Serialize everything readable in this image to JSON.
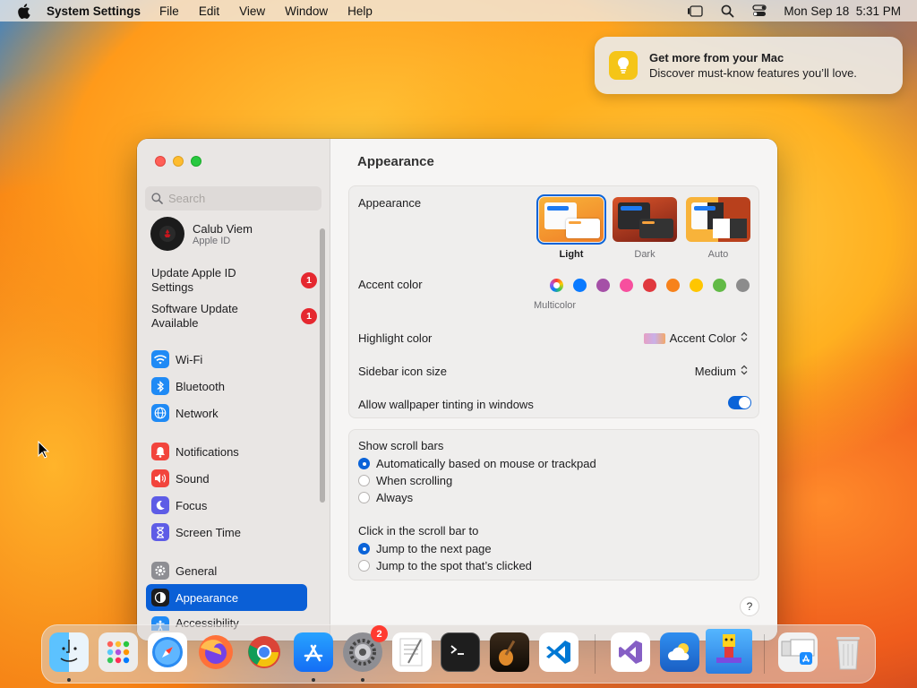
{
  "menubar": {
    "app_name": "System Settings",
    "menus": [
      "File",
      "Edit",
      "View",
      "Window",
      "Help"
    ],
    "datetime": "Mon Sep 18  5:31 PM"
  },
  "notification": {
    "title": "Get more from your Mac",
    "body": "Discover must-know features you’ll love."
  },
  "sidebar": {
    "search_placeholder": "Search",
    "account_name": "Calub Viem",
    "account_sub": "Apple ID",
    "alerts": [
      {
        "label": "Update Apple ID Settings",
        "badge": "1"
      },
      {
        "label": "Software Update Available",
        "badge": "1"
      }
    ],
    "items": [
      {
        "label": "Wi-Fi"
      },
      {
        "label": "Bluetooth"
      },
      {
        "label": "Network"
      },
      {
        "label": "Notifications"
      },
      {
        "label": "Sound"
      },
      {
        "label": "Focus"
      },
      {
        "label": "Screen Time"
      },
      {
        "label": "General"
      },
      {
        "label": "Appearance"
      },
      {
        "label": "Accessibility"
      }
    ]
  },
  "main": {
    "title": "Appearance",
    "appearance_label": "Appearance",
    "themes": [
      "Light",
      "Dark",
      "Auto"
    ],
    "selected_theme": "Light",
    "accent_label": "Accent color",
    "accent_selected_name": "Multicolor",
    "accent_colors": [
      "#ff3b30",
      "#0a7aff",
      "#a550a7",
      "#f74f9e",
      "#e0383e",
      "#f7821b",
      "#ffc600",
      "#62ba46",
      "#8c8c8c"
    ],
    "highlight_label": "Highlight color",
    "highlight_value": "Accent Color",
    "sidebar_icon_label": "Sidebar icon size",
    "sidebar_icon_value": "Medium",
    "tinting_label": "Allow wallpaper tinting in windows",
    "tinting_on": true,
    "scroll_bars_label": "Show scroll bars",
    "scroll_options": [
      "Automatically based on mouse or trackpad",
      "When scrolling",
      "Always"
    ],
    "scroll_selected": 0,
    "click_label": "Click in the scroll bar to",
    "click_options": [
      "Jump to the next page",
      "Jump to the spot that’s clicked"
    ],
    "click_selected": 0,
    "help": "?"
  },
  "dock": {
    "settings_badge": "2",
    "apps": [
      "Finder",
      "Launchpad",
      "Safari",
      "Firefox",
      "Chrome",
      "App Store",
      "System Settings",
      "TextEdit",
      "Terminal",
      "GarageBand",
      "VS Code",
      "Visual Studio",
      "Weather",
      "Game",
      "Downloads",
      "Trash"
    ]
  }
}
